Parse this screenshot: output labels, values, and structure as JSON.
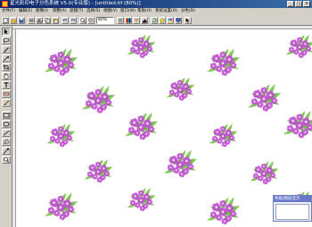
{
  "window": {
    "title": "星光彩印电子分色系统 V5.0(专业版) - [untitled.tif (80%)]",
    "icon": "app-icon",
    "buttons": [
      "minimize",
      "maximize",
      "close"
    ],
    "button_glyphs": {
      "minimize": "_",
      "maximize": "□",
      "close": "×"
    }
  },
  "menu": {
    "items": [
      "文件(F)",
      "编辑(E)",
      "图像(I)",
      "调整(A)",
      "滤镜(T)",
      "选择(S)",
      "视图(V)",
      "窗口(W)",
      "帮助(H)",
      "系统设置(O)",
      "分色(D)"
    ]
  },
  "toolbar": {
    "zoom_value": "80%"
  },
  "palette": {
    "tools": [
      "select-arrow-icon",
      "lasso-icon",
      "pen-icon",
      "magic-wand-icon",
      "crop-icon",
      "hand-icon",
      "text-icon",
      "eraser-icon",
      "brush-icon",
      "rectangle-icon",
      "ellipse-icon",
      "line-icon",
      "bucket-icon",
      "eyedropper-icon",
      "zoom-icon"
    ]
  },
  "canvas": {
    "pattern": "pink-flower-bouquets-green-leaves",
    "flower_color": "#c050d0",
    "leaf_color": "#70c040",
    "background": "#ffffff"
  },
  "mini_panel": {
    "title": "色板/图层显示"
  },
  "colors": {
    "titlebar_start": "#0a246a",
    "titlebar_end": "#3a6ea5",
    "chrome": "#d4d0c8"
  }
}
